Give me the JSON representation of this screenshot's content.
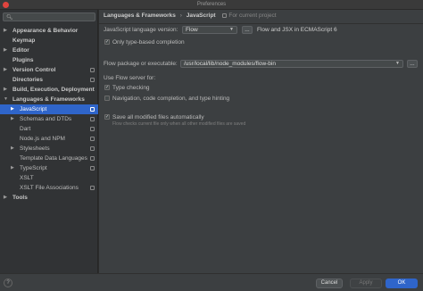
{
  "window": {
    "title": "Preferences"
  },
  "search": {
    "icon": "search-icon",
    "value": ""
  },
  "tree": [
    {
      "label": "Appearance & Behavior",
      "bold": true,
      "arrow": "right",
      "indent": 0
    },
    {
      "label": "Keymap",
      "bold": true,
      "arrow": "",
      "indent": 0
    },
    {
      "label": "Editor",
      "bold": true,
      "arrow": "right",
      "indent": 0
    },
    {
      "label": "Plugins",
      "bold": true,
      "arrow": "",
      "indent": 0
    },
    {
      "label": "Version Control",
      "bold": true,
      "arrow": "right",
      "indent": 0,
      "project": true
    },
    {
      "label": "Directories",
      "bold": true,
      "arrow": "",
      "indent": 0,
      "project": true
    },
    {
      "label": "Build, Execution, Deployment",
      "bold": true,
      "arrow": "right",
      "indent": 0
    },
    {
      "label": "Languages & Frameworks",
      "bold": true,
      "arrow": "down",
      "indent": 0
    },
    {
      "label": "JavaScript",
      "bold": false,
      "arrow": "right",
      "indent": 1,
      "selected": true,
      "project": true
    },
    {
      "label": "Schemas and DTDs",
      "bold": false,
      "arrow": "right",
      "indent": 1,
      "project": true
    },
    {
      "label": "Dart",
      "bold": false,
      "arrow": "",
      "indent": 1,
      "project": true
    },
    {
      "label": "Node.js and NPM",
      "bold": false,
      "arrow": "",
      "indent": 1,
      "project": true
    },
    {
      "label": "Stylesheets",
      "bold": false,
      "arrow": "right",
      "indent": 1,
      "project": true
    },
    {
      "label": "Template Data Languages",
      "bold": false,
      "arrow": "",
      "indent": 1,
      "project": true
    },
    {
      "label": "TypeScript",
      "bold": false,
      "arrow": "right",
      "indent": 1,
      "project": true
    },
    {
      "label": "XSLT",
      "bold": false,
      "arrow": "",
      "indent": 1
    },
    {
      "label": "XSLT File Associations",
      "bold": false,
      "arrow": "",
      "indent": 1,
      "project": true
    },
    {
      "label": "Tools",
      "bold": true,
      "arrow": "right",
      "indent": 0
    }
  ],
  "breadcrumb": {
    "part1": "Languages & Frameworks",
    "separator": "›",
    "part2": "JavaScript",
    "note": "For current project"
  },
  "js_version": {
    "label": "JavaScript language version:",
    "value": "Flow",
    "more_button": "...",
    "description": "Flow and JSX in ECMAScript 6"
  },
  "only_type_based": {
    "label": "Only type-based completion",
    "checked": true
  },
  "flow_package": {
    "label": "Flow package or executable:",
    "value": "/usr/local/lib/node_modules/flow-bin",
    "more_button": "..."
  },
  "use_flow_server": {
    "label": "Use Flow server for:",
    "type_checking": {
      "label": "Type checking",
      "checked": true
    },
    "navigation": {
      "label": "Navigation, code completion, and type hinting",
      "checked": false
    }
  },
  "save_all": {
    "label": "Save all modified files automatically",
    "checked": true,
    "hint": "Flow checks current file only when all other modified files are saved"
  },
  "footer": {
    "help": "?",
    "cancel": "Cancel",
    "apply": "Apply",
    "ok": "OK"
  },
  "colors": {
    "accent": "#2f65ca",
    "background": "#3c3f41",
    "sidebar": "#313335"
  }
}
